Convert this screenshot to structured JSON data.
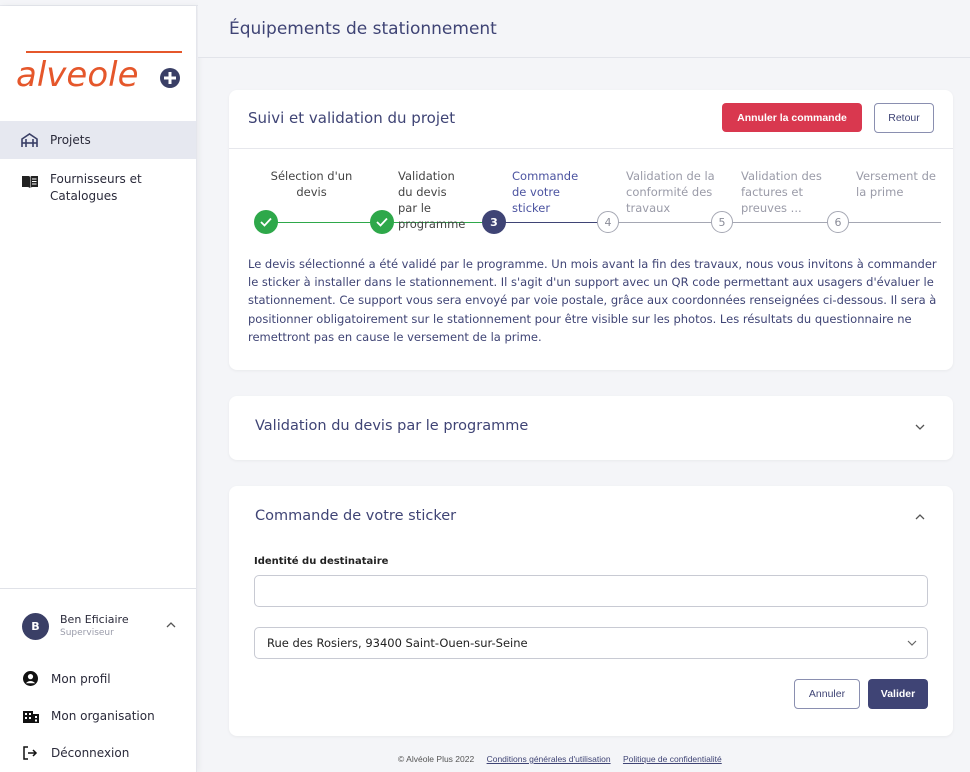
{
  "sidebar": {
    "logo_text": "alveole",
    "nav": [
      {
        "label": "Projets",
        "icon": "bike-parking-icon"
      },
      {
        "label": "Fournisseurs et Catalogues",
        "icon": "catalog-book-icon"
      }
    ],
    "user": {
      "initial": "B",
      "name": "Ben Eficiaire",
      "role": "Superviseur"
    },
    "bottom": [
      {
        "label": "Mon profil",
        "icon": "user-circle-icon"
      },
      {
        "label": "Mon organisation",
        "icon": "building-icon"
      },
      {
        "label": "Déconnexion",
        "icon": "logout-icon"
      }
    ]
  },
  "header": {
    "title": "Équipements de stationnement"
  },
  "tracking": {
    "title": "Suivi et validation du projet",
    "cancel_order_label": "Annuler la commande",
    "back_label": "Retour",
    "steps": [
      {
        "label": "Sélection d'un devis",
        "status": "done"
      },
      {
        "label": "Validation du devis par le programme",
        "status": "done"
      },
      {
        "label": "Commande de votre sticker",
        "status": "current",
        "number": "3"
      },
      {
        "label": "Validation de la conformité des travaux",
        "status": "todo",
        "number": "4"
      },
      {
        "label": "Validation des factures et preuves ...",
        "status": "todo",
        "number": "5"
      },
      {
        "label": "Versement de la prime",
        "status": "todo",
        "number": "6"
      }
    ],
    "description": "Le devis sélectionné a été validé par le programme. Un mois avant la fin des travaux, nous vous invitons à commander le sticker à installer dans le stationnement. Il s'agit d'un support avec un QR code permettant aux usagers d'évaluer le stationnement. Ce support vous sera envoyé par voie postale, grâce aux coordonnées renseignées ci-dessous. Il sera à positionner obligatoirement sur le stationnement pour être visible sur les photos. Les résultats du questionnaire ne remettront pas en cause le versement de la prime."
  },
  "validation_section": {
    "title": "Validation du devis par le programme"
  },
  "order_section": {
    "title": "Commande de votre sticker",
    "recipient_label": "Identité du destinataire",
    "recipient_value": "",
    "address_value": "Rue des Rosiers, 93400 Saint-Ouen-sur-Seine",
    "cancel_label": "Annuler",
    "submit_label": "Valider"
  },
  "footer": {
    "copyright": "© Alvéole Plus 2022",
    "cgu": "Conditions générales d'utilisation",
    "privacy": "Politique de confidentialité"
  },
  "colors": {
    "primary": "#3f4475",
    "danger": "#d9384f",
    "success": "#2ea84a",
    "logo": "#e5572b"
  }
}
